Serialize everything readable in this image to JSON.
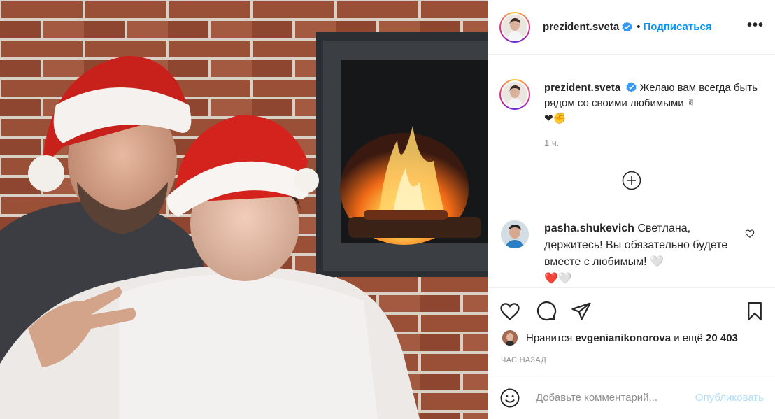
{
  "post": {
    "photo_alt": "",
    "header": {
      "username": "prezident.sveta",
      "separator": "•",
      "follow_label": "Подписаться",
      "more_label": "•••"
    },
    "caption": {
      "username": "prezident.sveta",
      "text": "Желаю вам всегда быть рядом со своими любимыми ✌",
      "emoji_line": "❤✊",
      "time": "1 ч."
    },
    "comment": {
      "username": "pasha.shukevich",
      "text": "Светлана, держитесь! Вы обязательно будете вместе с любимым! 🤍",
      "emoji_line": "❤️🤍"
    },
    "likes": {
      "prefix": "Нравится",
      "liked_by": "evgenianikonorova",
      "middle": "и ещё",
      "count": "20 403"
    },
    "posted_ago": "ЧАС НАЗАД",
    "add_comment": {
      "placeholder": "Добавьте комментарий...",
      "publish_label": "Опубликовать"
    },
    "icons": {
      "verified": "verified-badge-icon",
      "more": "more-options-icon",
      "load_more": "plus-circle-icon",
      "like": "heart-icon",
      "comment": "comment-bubble-icon",
      "share": "paper-plane-icon",
      "save": "bookmark-icon",
      "emoji": "smiley-icon"
    },
    "colors": {
      "accent": "#0095f6",
      "muted": "#8e8e8e",
      "publish_disabled": "#b2dffc",
      "border": "#efefef",
      "text": "#262626"
    }
  }
}
